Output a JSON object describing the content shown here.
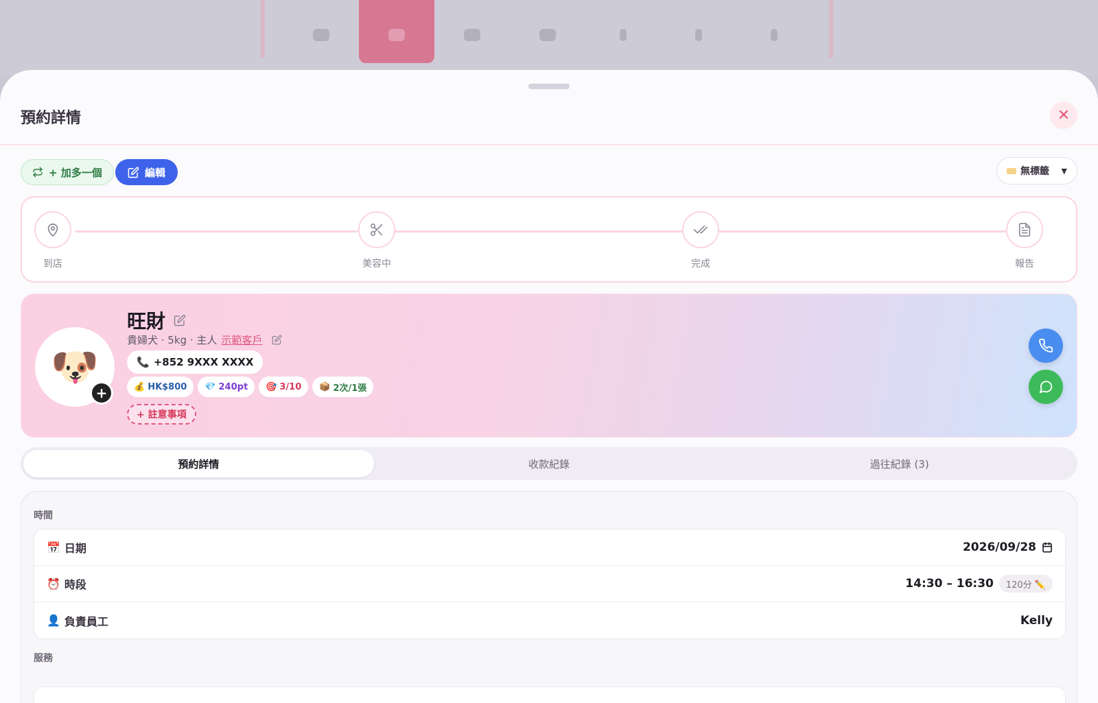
{
  "sheet": {
    "title": "預約詳情"
  },
  "toolbar": {
    "add_label": "+ 加多一個",
    "edit_label": "編輯",
    "tag_label": "無標籤"
  },
  "progress": {
    "steps": [
      "到店",
      "美容中",
      "完成",
      "報告"
    ]
  },
  "pet": {
    "name": "旺財",
    "emoji": "🐶",
    "meta_prefix": "貴婦犬 · 5kg · 主人",
    "owner": "示範客戶",
    "phone": "+852 9XXX XXXX",
    "chips": [
      {
        "icon": "💰",
        "text": "HK$800",
        "color": "#2a5fa8"
      },
      {
        "icon": "💎",
        "text": "240pt",
        "color": "#7b3fd4"
      },
      {
        "icon": "🎯",
        "text": "3/10",
        "color": "#d63a5c"
      },
      {
        "icon": "📦",
        "text": "2次/1張",
        "color": "#2f7c45"
      }
    ],
    "note_label": "+ 註意事項"
  },
  "tabs": [
    "預約詳情",
    "收款紀錄",
    "過往紀錄 (3)"
  ],
  "details": {
    "time_section": "時間",
    "rows": [
      {
        "icon": "📅",
        "label": "日期",
        "value": "2026/09/28"
      },
      {
        "icon": "⏰",
        "label": "時段",
        "value": "14:30 – 16:30",
        "badge": "120分 ✏️"
      },
      {
        "icon": "👤",
        "label": "負責員工",
        "value": "Kelly"
      }
    ],
    "service_section": "服務"
  },
  "colors": {
    "accent": "#3e63ea",
    "pink": "#e0587e",
    "green": "#3dbb5b",
    "blue": "#4a8df0"
  }
}
